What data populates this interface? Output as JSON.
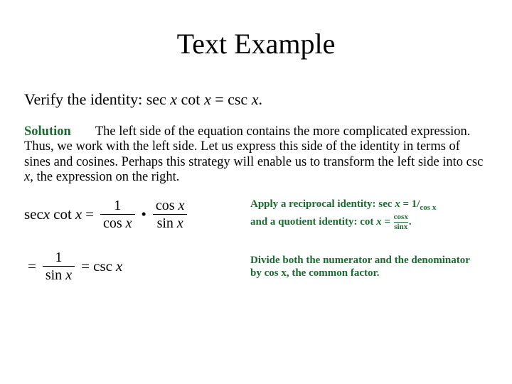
{
  "title": "Text Example",
  "prompt": {
    "lead": "Verify the identity: ",
    "expr_lhs": "sec ",
    "expr_lhs_var": "x ",
    "expr_mid": "cot ",
    "expr_mid_var": "x ",
    "expr_eq": "= csc ",
    "expr_rhs_var": "x",
    "period": "."
  },
  "solution": {
    "label": "Solution",
    "text_before_italic": "The left side of the equation contains the more complicated expression. Thus, we work with the left side. Let us express this side of the identity in terms of sines and cosines. Perhaps this strategy will enable us to transform the left side into csc ",
    "italic": "x",
    "text_after_italic": ", the expression on the right."
  },
  "row1": {
    "f": {
      "pre": "sec",
      "prex": "x",
      "mid": "cot",
      "midx": "x",
      "eq": "=",
      "f1n": "1",
      "f1d_cos": "cos",
      "f1d_x": "x",
      "dot": "•",
      "f2n_cos": "cos",
      "f2n_x": "x",
      "f2d_sin": "sin",
      "f2d_x": "x"
    },
    "note": {
      "l1a": "Apply a reciprocal identity: sec ",
      "l1x": "x ",
      "l1b": "= 1/",
      "l1c": "cos x",
      "l2a": "and a quotient identity:  cot ",
      "l2x": "x ",
      "l2b": "= ",
      "l2n": "cosx",
      "l2d": "sinx",
      "l2p": "."
    }
  },
  "row2": {
    "f": {
      "eq1": "=",
      "n": "1",
      "d_sin": "sin",
      "d_x": "x",
      "eq2": "= csc",
      "x": "x"
    },
    "note": {
      "l1": "Divide both the numerator and the denominator by cos x, the common factor."
    }
  }
}
